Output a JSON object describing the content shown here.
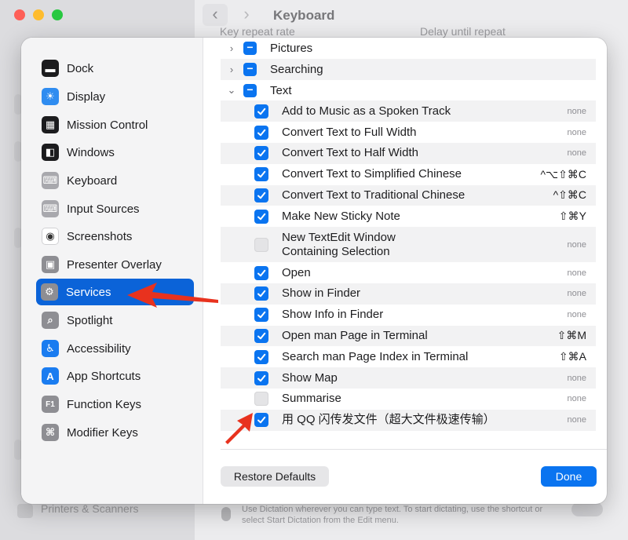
{
  "window": {
    "title": "Keyboard",
    "back_glyph": "‹",
    "forward_glyph": "›",
    "key_repeat_label": "Key repeat rate",
    "delay_label": "Delay until repeat",
    "bottom_sidebar_item": "Printers & Scanners",
    "dictation_text": "Use Dictation wherever you can type text. To start dictating, use the shortcut or select Start Dictation from the Edit menu."
  },
  "sidebar": {
    "items": [
      {
        "label": "Dock",
        "icon": "dock-icon",
        "color": "#1c1c1e",
        "glyph": "▬"
      },
      {
        "label": "Display",
        "icon": "display-icon",
        "color": "#2f8cf0",
        "glyph": "☀"
      },
      {
        "label": "Mission Control",
        "icon": "mission-control-icon",
        "color": "#1c1c1e",
        "glyph": "▦"
      },
      {
        "label": "Windows",
        "icon": "windows-icon",
        "color": "#1c1c1e",
        "glyph": "◧"
      },
      {
        "label": "Keyboard",
        "icon": "keyboard-icon",
        "color": "#a8a8ad",
        "glyph": "⌨"
      },
      {
        "label": "Input Sources",
        "icon": "input-sources-icon",
        "color": "#a8a8ad",
        "glyph": "⌨"
      },
      {
        "label": "Screenshots",
        "icon": "screenshots-icon",
        "color": "#ffffff",
        "glyph": "◉"
      },
      {
        "label": "Presenter Overlay",
        "icon": "presenter-overlay-icon",
        "color": "#8e8e93",
        "glyph": "▣"
      },
      {
        "label": "Services",
        "icon": "services-icon",
        "color": "#8e8e93",
        "glyph": "⚙"
      },
      {
        "label": "Spotlight",
        "icon": "spotlight-icon",
        "color": "#8e8e93",
        "glyph": "⌕"
      },
      {
        "label": "Accessibility",
        "icon": "accessibility-icon",
        "color": "#1a7cf0",
        "glyph": "♿"
      },
      {
        "label": "App Shortcuts",
        "icon": "app-shortcuts-icon",
        "color": "#1a7cf0",
        "glyph": "A"
      },
      {
        "label": "Function Keys",
        "icon": "function-keys-icon",
        "color": "#8e8e93",
        "glyph": "F1"
      },
      {
        "label": "Modifier Keys",
        "icon": "modifier-keys-icon",
        "color": "#8e8e93",
        "glyph": "⌘"
      }
    ],
    "active_index": 8
  },
  "services": {
    "groups": [
      {
        "label": "Pictures",
        "expanded": false,
        "disclosure": "›"
      },
      {
        "label": "Searching",
        "expanded": false,
        "disclosure": "›"
      },
      {
        "label": "Text",
        "expanded": true,
        "disclosure": "⌄"
      }
    ],
    "group_marker": "−",
    "items": [
      {
        "label": "Add to Music as a Spoken Track",
        "checked": true,
        "shortcut": "none"
      },
      {
        "label": "Convert Text to Full Width",
        "checked": true,
        "shortcut": "none"
      },
      {
        "label": "Convert Text to Half Width",
        "checked": true,
        "shortcut": "none"
      },
      {
        "label": "Convert Text to Simplified Chinese",
        "checked": true,
        "shortcut": "^⌥⇧⌘C"
      },
      {
        "label": "Convert Text to Traditional Chinese",
        "checked": true,
        "shortcut": "^⇧⌘C"
      },
      {
        "label": "Make New Sticky Note",
        "checked": true,
        "shortcut": "⇧⌘Y"
      },
      {
        "label": "New TextEdit Window",
        "label2": "Containing Selection",
        "checked": false,
        "shortcut": "none"
      },
      {
        "label": "Open",
        "checked": true,
        "shortcut": "none"
      },
      {
        "label": "Show in Finder",
        "checked": true,
        "shortcut": "none"
      },
      {
        "label": "Show Info in Finder",
        "checked": true,
        "shortcut": "none"
      },
      {
        "label": "Open man Page in Terminal",
        "checked": true,
        "shortcut": "⇧⌘M"
      },
      {
        "label": "Search man Page Index in Terminal",
        "checked": true,
        "shortcut": "⇧⌘A"
      },
      {
        "label": "Show Map",
        "checked": true,
        "shortcut": "none"
      },
      {
        "label": "Summarise",
        "checked": false,
        "shortcut": "none"
      },
      {
        "label": "用 QQ 闪传发文件（超大文件极速传输）",
        "checked": true,
        "shortcut": "none"
      }
    ]
  },
  "footer": {
    "restore_label": "Restore Defaults",
    "done_label": "Done"
  },
  "colors": {
    "accent": "#0a74f0",
    "selection": "#0b63d8",
    "annotation_arrow": "#e8321e"
  }
}
